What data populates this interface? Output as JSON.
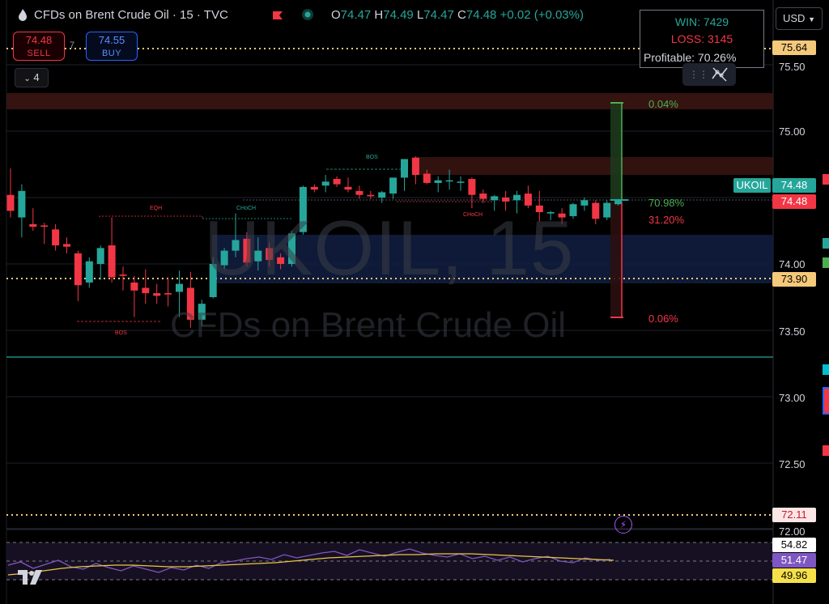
{
  "header": {
    "symbol_title": "CFDs on Brent Crude Oil · 15 · TVC",
    "ohlc": {
      "o_label": "O",
      "o": "74.47",
      "h_label": "H",
      "h": "74.49",
      "l_label": "L",
      "l": "74.47",
      "c_label": "C",
      "c": "74.48",
      "change": "+0.02 (+0.03%)"
    },
    "currency": "USD"
  },
  "trade": {
    "sell_price": "74.48",
    "sell_label": "SELL",
    "buy_price": "74.55",
    "buy_label": "BUY",
    "spread": "7",
    "collapse_count": "4"
  },
  "stats_box": {
    "win": "WIN: 7429",
    "loss": "LOSS: 3145",
    "profitable": "Profitable: 70.26%"
  },
  "watermark": {
    "line1": "UKOIL, 15",
    "line2": "CFDs on Brent Crude Oil"
  },
  "axis": {
    "ticks": [
      "75.50",
      "75.00",
      "74.50",
      "74.00",
      "73.50",
      "73.00",
      "72.50",
      "72.00"
    ],
    "badges": {
      "top_level": "75.64",
      "symbol_price_a": "74.48",
      "symbol_price_b": "74.48",
      "level_mid": "73.90",
      "level_low": "72.11",
      "rsi_high": "54.82",
      "rsi_value": "51.47",
      "rsi_low": "49.96"
    },
    "symbol_tag": "UKOIL"
  },
  "annotations": {
    "tp_pct": "0.04%",
    "win_pct": "70.98%",
    "loss_pct": "31.20%",
    "sl_pct": "0.06%",
    "bos_top": "BOS",
    "bos_bottom": "BOS",
    "eqh": "EQH",
    "choch_left": "CHoCH",
    "choch_right": "CHoCH"
  },
  "colors": {
    "bull": "#26a69a",
    "bear": "#f23645",
    "accent": "#2962ff",
    "rsi": "#7e57c2",
    "ma": "#e8c547"
  },
  "icons": {
    "flame": "flame-icon",
    "flag": "flag-icon",
    "status": "status-dot-icon",
    "tools": "drawing-tools-icon",
    "bolt": "lightning-icon",
    "logo": "tradingview-logo"
  }
}
